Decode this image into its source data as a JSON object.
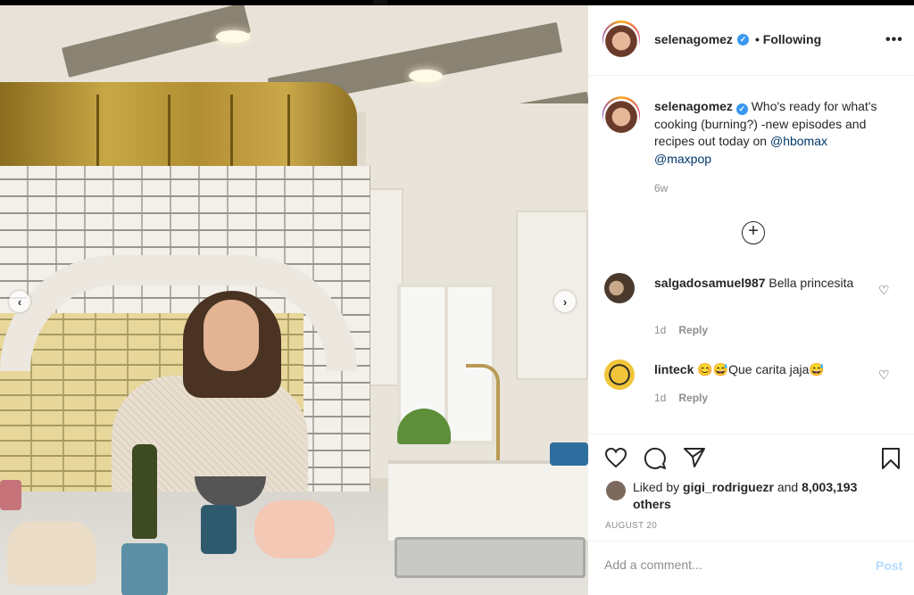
{
  "post": {
    "author": "selenagomez",
    "follow_status": "Following",
    "more_icon": "•••",
    "verified_icon": "✓"
  },
  "caption": {
    "username": "selenagomez",
    "text": " Who's ready for what's cooking (burning?) -new episodes and recipes out today on ",
    "mention1": "@hbomax",
    "mention2": "@maxpop",
    "time": "6w"
  },
  "load_more_icon": "+",
  "comments": [
    {
      "username": "salgadosamuel987",
      "text": " Bella princesita",
      "time": "1d",
      "reply": "Reply"
    },
    {
      "username": "linteck",
      "text": " 😊😅Que carita jaja😅",
      "time": "1d",
      "reply": "Reply"
    }
  ],
  "actions": {
    "like_icon": "heart-icon",
    "comment_icon": "comment-icon",
    "share_icon": "share-icon",
    "save_icon": "bookmark-icon"
  },
  "likes": {
    "prefix": "Liked by ",
    "user": "gigi_rodriguezr",
    "middle": " and ",
    "count": "8,003,193 others"
  },
  "date": "AUGUST 20",
  "add_comment": {
    "placeholder": "Add a comment...",
    "post_label": "Post"
  },
  "colors": {
    "link": "#00376b",
    "verified": "#3897f0",
    "post_disabled": "#b3dbff",
    "muted": "#8e8e8e"
  }
}
